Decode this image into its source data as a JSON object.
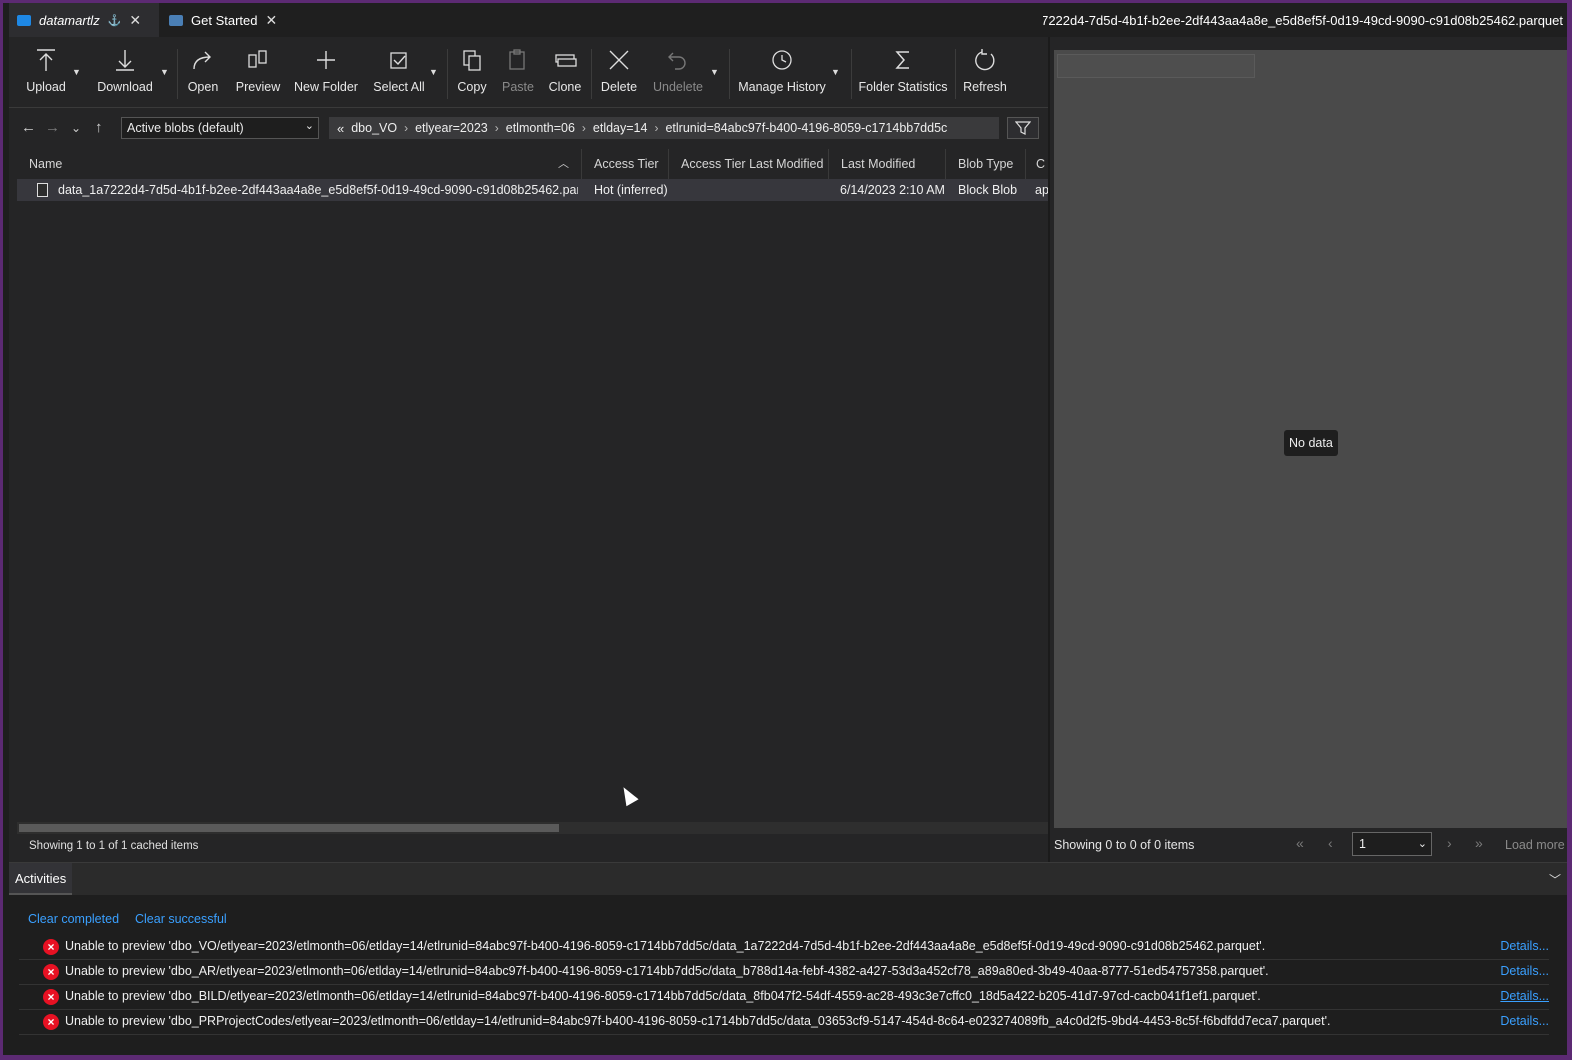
{
  "tabs": [
    {
      "label": "datamartlz",
      "icon": "storage-account-icon"
    },
    {
      "label": "Get Started",
      "icon": "get-started-icon"
    }
  ],
  "preview_title": "data_1a7222d4-7d5d-4b1f-b2ee-2df443aa4a8e_e5d8ef5f-0d19-49cd-9090-c91d08b25462.parquet",
  "toolbar": {
    "upload": "Upload",
    "download": "Download",
    "open": "Open",
    "preview": "Preview",
    "new_folder": "New Folder",
    "select_all": "Select All",
    "copy": "Copy",
    "paste": "Paste",
    "clone": "Clone",
    "delete": "Delete",
    "undelete": "Undelete",
    "manage_history": "Manage History",
    "folder_statistics": "Folder Statistics",
    "refresh": "Refresh"
  },
  "nav": {
    "view_mode": "Active blobs (default)",
    "breadcrumb": [
      "dbo_VO",
      "etlyear=2023",
      "etlmonth=06",
      "etlday=14",
      "etlrunid=84abc97f-b400-4196-8059-c1714bb7dd5c"
    ]
  },
  "table": {
    "columns": [
      "Name",
      "Access Tier",
      "Access Tier Last Modified",
      "Last Modified",
      "Blob Type",
      "C"
    ],
    "rows": [
      {
        "name": "data_1a7222d4-7d5d-4b1f-b2ee-2df443aa4a8e_e5d8ef5f-0d19-49cd-9090-c91d08b25462.parquet",
        "access_tier": "Hot (inferred)",
        "access_tier_modified": "",
        "last_modified": "6/14/2023 2:10 AM",
        "blob_type": "Block Blob",
        "content_type": "ap"
      }
    ],
    "status": "Showing 1 to 1 of 1 cached items"
  },
  "preview": {
    "empty_text": "No data",
    "status": "Showing 0 to 0 of 0 items",
    "page": "1",
    "load_more": "Load more"
  },
  "activities": {
    "title": "Activities",
    "clear_completed": "Clear completed",
    "clear_successful": "Clear successful",
    "details_label": "Details...",
    "items": [
      "Unable to preview 'dbo_VO/etlyear=2023/etlmonth=06/etlday=14/etlrunid=84abc97f-b400-4196-8059-c1714bb7dd5c/data_1a7222d4-7d5d-4b1f-b2ee-2df443aa4a8e_e5d8ef5f-0d19-49cd-9090-c91d08b25462.parquet'.",
      "Unable to preview 'dbo_AR/etlyear=2023/etlmonth=06/etlday=14/etlrunid=84abc97f-b400-4196-8059-c1714bb7dd5c/data_b788d14a-febf-4382-a427-53d3a452cf78_a89a80ed-3b49-40aa-8777-51ed54757358.parquet'.",
      "Unable to preview 'dbo_BILD/etlyear=2023/etlmonth=06/etlday=14/etlrunid=84abc97f-b400-4196-8059-c1714bb7dd5c/data_8fb047f2-54df-4559-ac28-493c3e7cffc0_18d5a422-b205-41d7-97cd-cacb041f1ef1.parquet'.",
      "Unable to preview 'dbo_PRProjectCodes/etlyear=2023/etlmonth=06/etlday=14/etlrunid=84abc97f-b400-4196-8059-c1714bb7dd5c/data_03653cf9-5147-454d-8c64-e023274089fb_a4c0d2f5-9bd4-4453-8c5f-f6bdfdd7eca7.parquet'."
    ]
  },
  "colors": {
    "accent": "#3aa0ff",
    "error": "#e81123",
    "window_border": "#5c2a73"
  }
}
